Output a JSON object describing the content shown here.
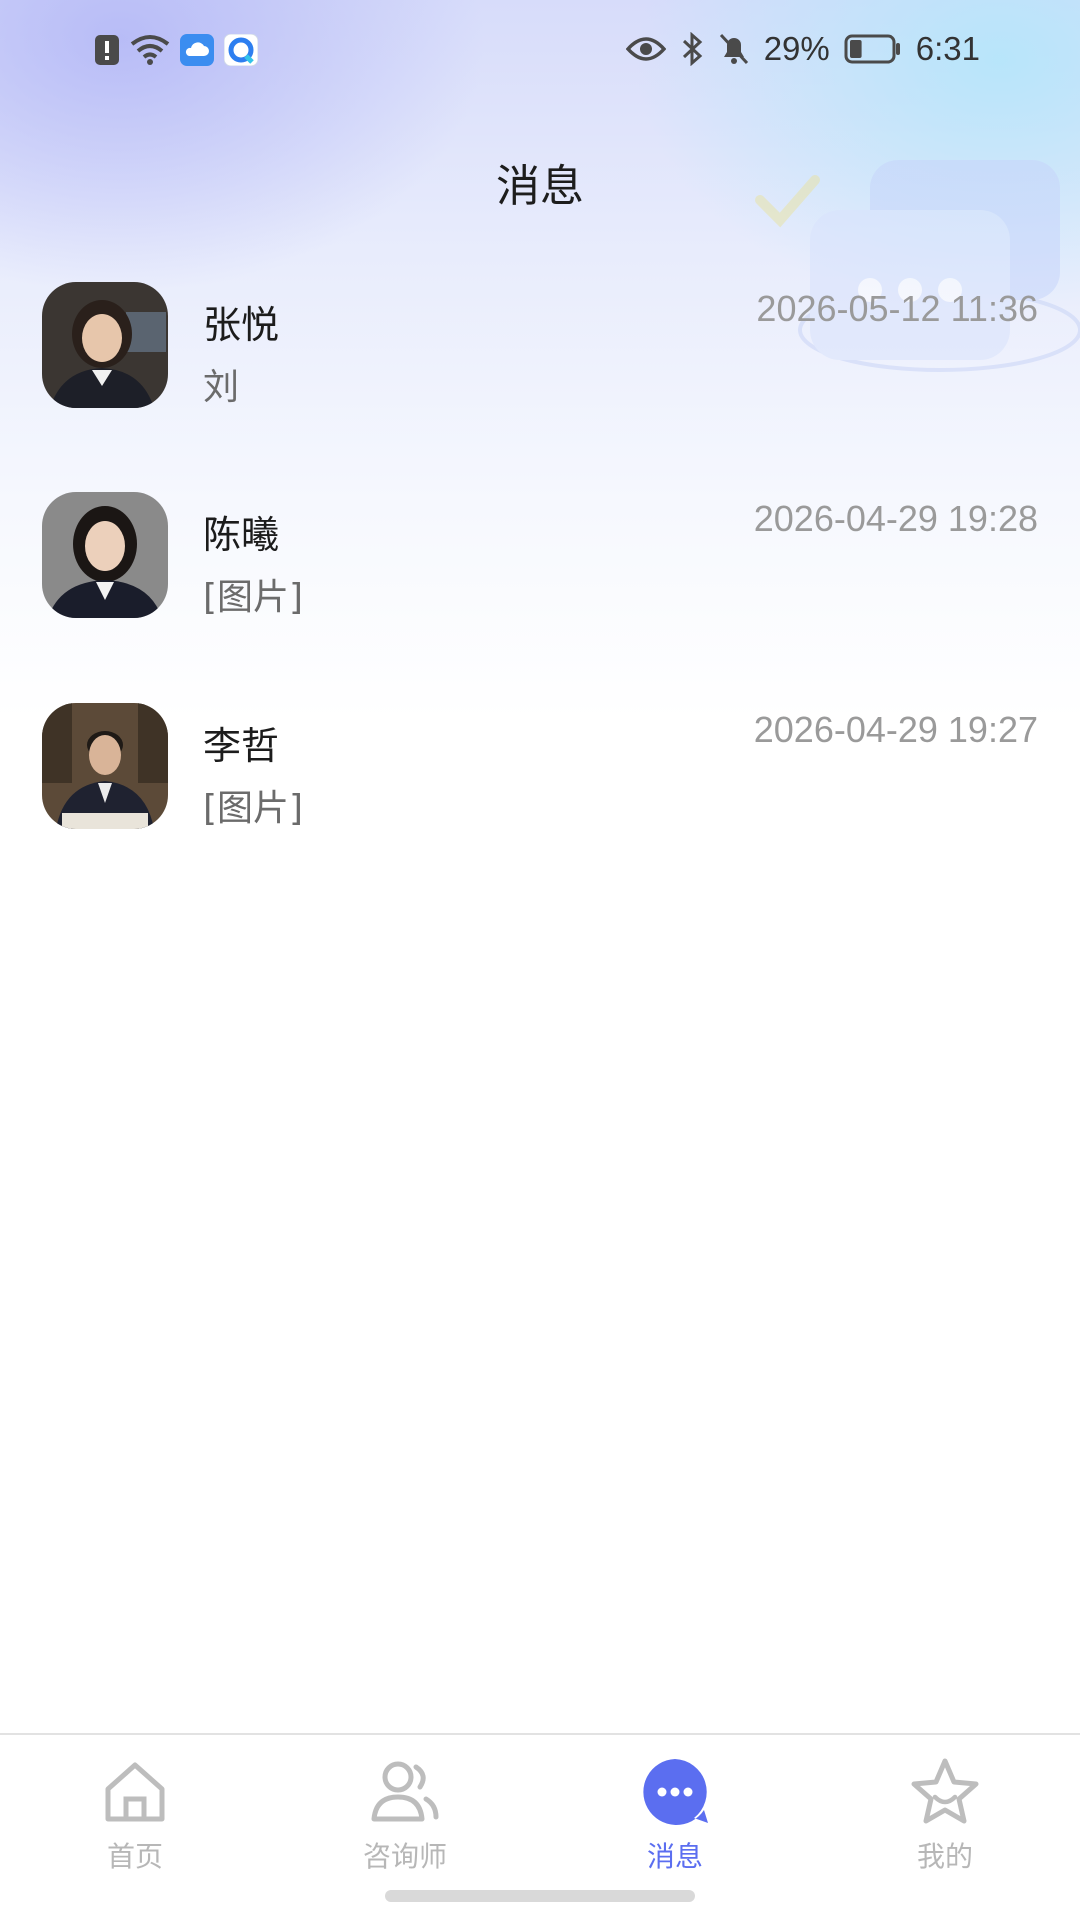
{
  "status_bar": {
    "left_icons": [
      "alert-icon",
      "wifi-icon",
      "cloud-app-icon",
      "browser-app-icon"
    ],
    "right_icons": [
      "eye-icon",
      "bluetooth-icon",
      "mute-bell-icon",
      "battery-icon"
    ],
    "battery_percent": "29%",
    "battery_level": 0.29,
    "time": "6:31"
  },
  "header": {
    "title": "消息"
  },
  "conversations": [
    {
      "name": "张悦",
      "preview": "刘",
      "time": "2026-05-12 11:36"
    },
    {
      "name": "陈曦",
      "preview": "[图片]",
      "time": "2026-04-29 19:28"
    },
    {
      "name": "李哲",
      "preview": "[图片]",
      "time": "2026-04-29 19:27"
    }
  ],
  "tabbar": {
    "items": [
      {
        "label": "首页",
        "icon": "home-icon",
        "active": false
      },
      {
        "label": "咨询师",
        "icon": "people-icon",
        "active": false
      },
      {
        "label": "消息",
        "icon": "chat-bubble-icon",
        "active": true
      },
      {
        "label": "我的",
        "icon": "star-icon",
        "active": false
      }
    ]
  },
  "colors": {
    "accent": "#5b6ef0",
    "inactive": "#b7b7b7",
    "timestamp": "#9a9a9a"
  }
}
